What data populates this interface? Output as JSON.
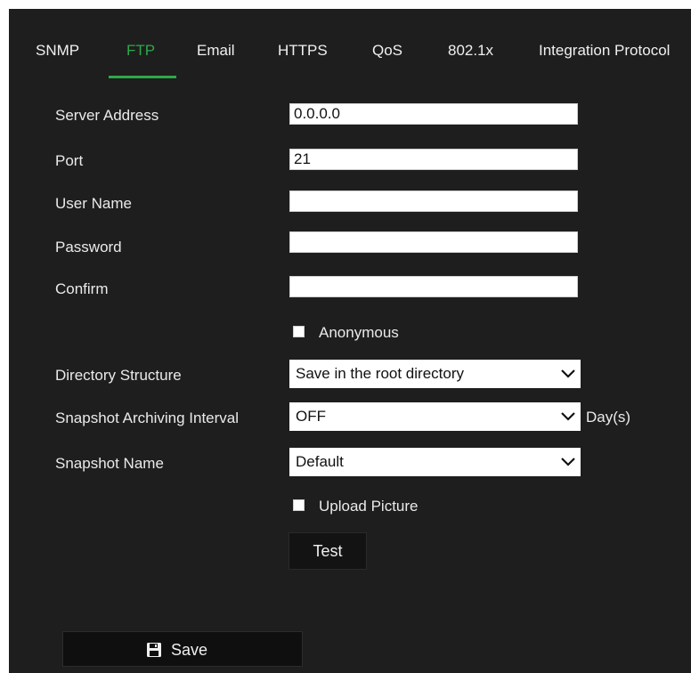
{
  "tabs": [
    {
      "label": "SNMP"
    },
    {
      "label": "FTP"
    },
    {
      "label": "Email"
    },
    {
      "label": "HTTPS"
    },
    {
      "label": "QoS"
    },
    {
      "label": "802.1x"
    },
    {
      "label": "Integration Protocol"
    }
  ],
  "active_tab": "FTP",
  "colors": {
    "accent": "#2ea84a",
    "panel": "#1e1e1e"
  },
  "form": {
    "server_address": {
      "label": "Server Address",
      "value": "0.0.0.0"
    },
    "port": {
      "label": "Port",
      "value": "21"
    },
    "user_name": {
      "label": "User Name",
      "value": ""
    },
    "password": {
      "label": "Password",
      "value": ""
    },
    "confirm": {
      "label": "Confirm",
      "value": ""
    },
    "anonymous": {
      "label": "Anonymous",
      "checked": false
    },
    "directory_structure": {
      "label": "Directory Structure",
      "value": "Save in the root directory"
    },
    "snapshot_interval": {
      "label": "Snapshot Archiving Interval",
      "value": "OFF",
      "unit": "Day(s)"
    },
    "snapshot_name": {
      "label": "Snapshot Name",
      "value": "Default"
    },
    "upload_picture": {
      "label": "Upload Picture",
      "checked": false
    }
  },
  "buttons": {
    "test": "Test",
    "save": "Save",
    "save_icon": "floppy-disk-icon",
    "dropdown_icon": "chevron-down-icon"
  }
}
